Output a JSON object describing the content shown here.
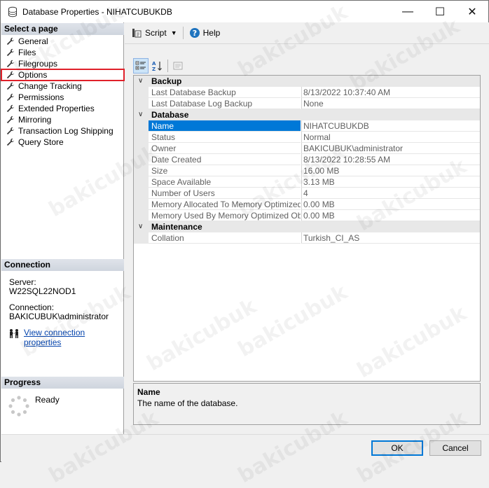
{
  "window": {
    "title": "Database Properties - NIHATCUBUKDB",
    "minimize_glyph": "—",
    "maximize_glyph": "☐",
    "close_glyph": "✕"
  },
  "select_page": {
    "header": "Select a page",
    "items": [
      {
        "label": "General"
      },
      {
        "label": "Files"
      },
      {
        "label": "Filegroups"
      },
      {
        "label": "Options"
      },
      {
        "label": "Change Tracking"
      },
      {
        "label": "Permissions"
      },
      {
        "label": "Extended Properties"
      },
      {
        "label": "Mirroring"
      },
      {
        "label": "Transaction Log Shipping"
      },
      {
        "label": "Query Store"
      }
    ],
    "selected_index": 3
  },
  "connection": {
    "header": "Connection",
    "server_label": "Server:",
    "server_value": "W22SQL22NOD1",
    "connection_label": "Connection:",
    "connection_value": "BAKICUBUK\\administrator",
    "view_link": "View connection properties"
  },
  "progress": {
    "header": "Progress",
    "status": "Ready"
  },
  "toolbar": {
    "script_label": "Script",
    "help_label": "Help"
  },
  "grid": {
    "categories": [
      {
        "name": "Backup",
        "rows": [
          {
            "name": "Last Database Backup",
            "value": "8/13/2022 10:37:40 AM"
          },
          {
            "name": "Last Database Log Backup",
            "value": "None"
          }
        ]
      },
      {
        "name": "Database",
        "rows": [
          {
            "name": "Name",
            "value": "NIHATCUBUKDB"
          },
          {
            "name": "Status",
            "value": "Normal"
          },
          {
            "name": "Owner",
            "value": "BAKICUBUK\\administrator"
          },
          {
            "name": "Date Created",
            "value": "8/13/2022 10:28:55 AM"
          },
          {
            "name": "Size",
            "value": "16.00 MB"
          },
          {
            "name": "Space Available",
            "value": "3.13 MB"
          },
          {
            "name": "Number of Users",
            "value": "4"
          },
          {
            "name": "Memory Allocated To Memory Optimized Objects",
            "value": "0.00 MB"
          },
          {
            "name": "Memory Used By Memory Optimized Objects",
            "value": "0.00 MB"
          }
        ]
      },
      {
        "name": "Maintenance",
        "rows": [
          {
            "name": "Collation",
            "value": "Turkish_CI_AS"
          }
        ]
      }
    ]
  },
  "description": {
    "title": "Name",
    "text": "The name of the database."
  },
  "buttons": {
    "ok": "OK",
    "cancel": "Cancel"
  },
  "watermark": "bakicubuk",
  "colors": {
    "selection": "#0078d7",
    "highlight_outline": "#e0202a",
    "link": "#0645ad"
  }
}
